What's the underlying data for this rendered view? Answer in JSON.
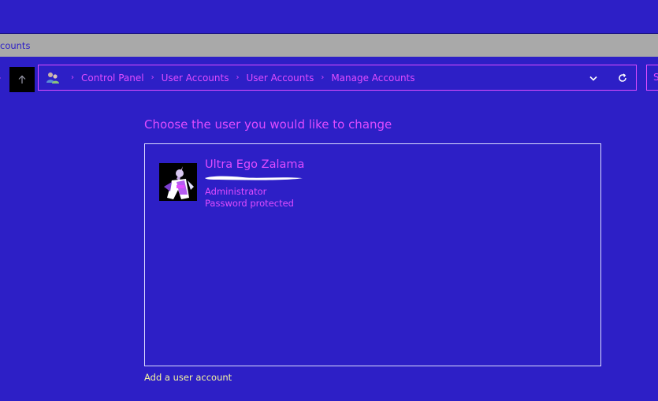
{
  "window": {
    "tab_label": "counts"
  },
  "address_bar": {
    "breadcrumbs": [
      {
        "label": "Control Panel"
      },
      {
        "label": "User Accounts"
      },
      {
        "label": "User Accounts"
      },
      {
        "label": "Manage Accounts"
      }
    ],
    "separator": "›",
    "search_hint": "S"
  },
  "main": {
    "heading": "Choose the user you would like to change",
    "accounts": [
      {
        "name": "Ultra Ego Zalama",
        "email_redacted": true,
        "role": "Administrator",
        "status": "Password protected"
      }
    ],
    "add_account_link": "Add a user account"
  },
  "colors": {
    "background": "#2d1fc6",
    "accent": "#e04cff",
    "tab_strip": "#a9a9a9",
    "link": "#f5f5a0",
    "border": "#dcdcff"
  },
  "icons": {
    "up": "up-arrow-icon",
    "location": "user-accounts-icon",
    "dropdown": "chevron-down-icon",
    "refresh": "refresh-icon"
  }
}
